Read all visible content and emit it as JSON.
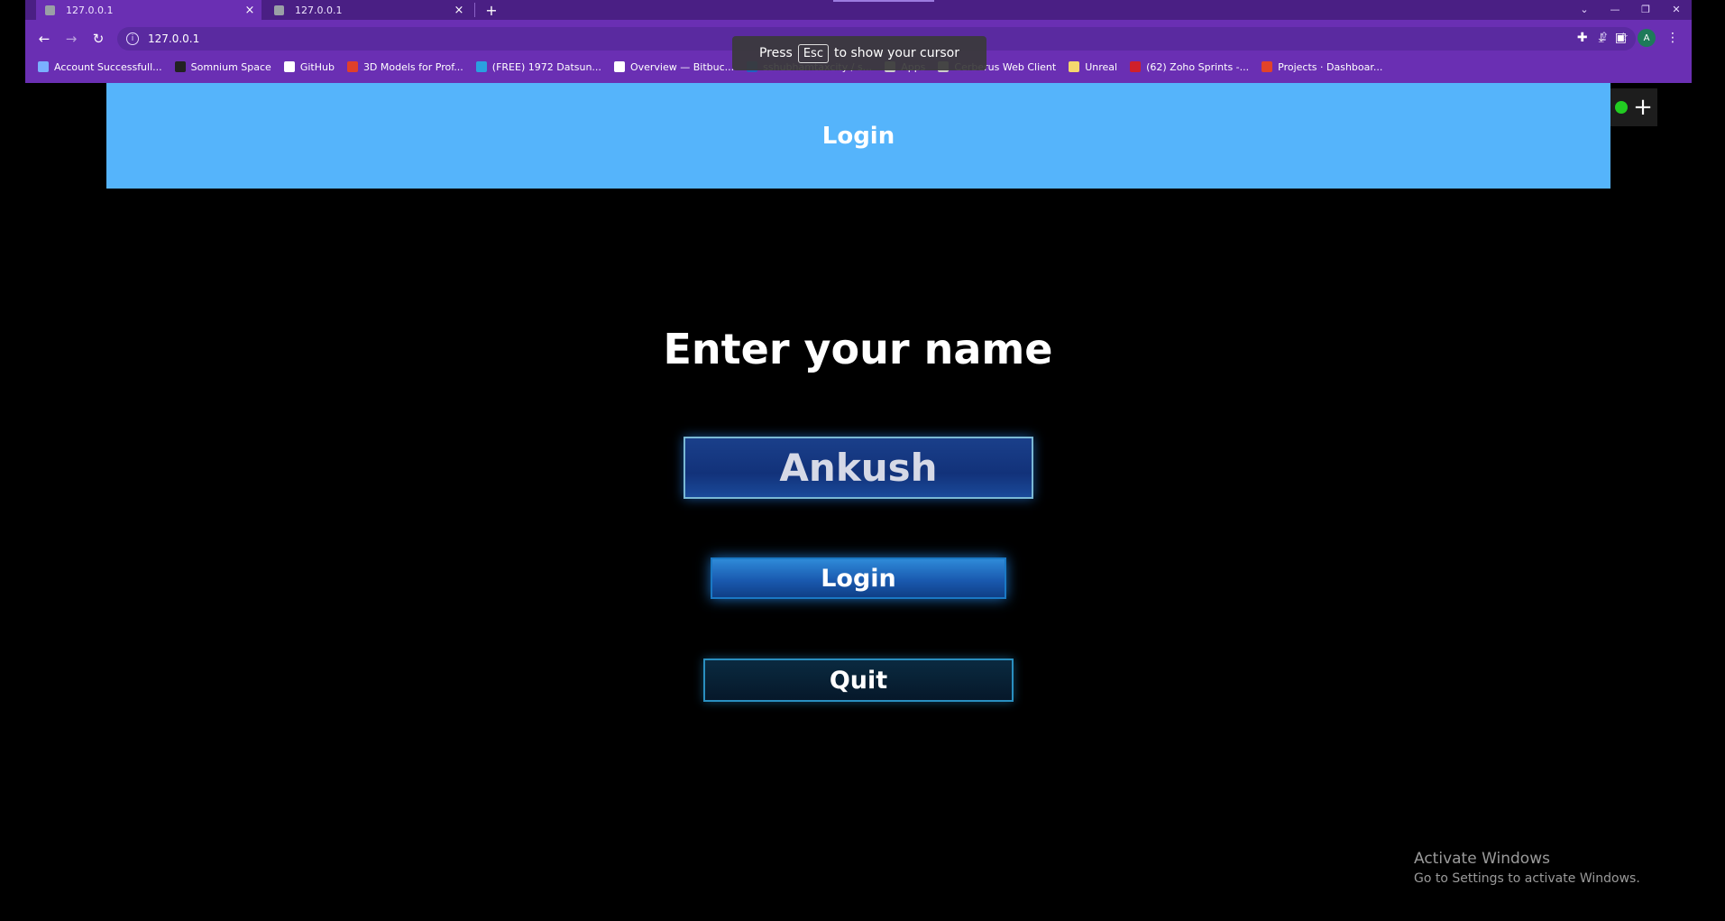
{
  "browser": {
    "tabs": [
      {
        "label": "127.0.0.1",
        "active": true
      },
      {
        "label": "127.0.0.1",
        "active": false
      }
    ],
    "new_tab_symbol": "+",
    "address": "127.0.0.1",
    "bookmarks": [
      {
        "label": "Account Successfull...",
        "icon": "bookmark-icon",
        "color": "#7ab0ff"
      },
      {
        "label": "Somnium Space",
        "icon": "cube-icon",
        "color": "#222222"
      },
      {
        "label": "GitHub",
        "icon": "github-icon",
        "color": "#ffffff"
      },
      {
        "label": "3D Models for Prof...",
        "icon": "star-icon",
        "color": "#e0402a"
      },
      {
        "label": "(FREE) 1972 Datsun...",
        "icon": "globe-icon",
        "color": "#2aa0e0"
      },
      {
        "label": "Overview — Bitbuc...",
        "icon": "globe-icon",
        "color": "#ffffff"
      },
      {
        "label": "sshubhamtaxcity / s...",
        "icon": "repo-icon",
        "color": "#2060c0"
      },
      {
        "label": "Apps",
        "icon": "apps-grid-icon",
        "color": "#cccccc"
      },
      {
        "label": "Cerberus Web Client",
        "icon": "document-icon",
        "color": "#cccccc"
      },
      {
        "label": "Unreal",
        "icon": "folder-icon",
        "color": "#f5d76e"
      },
      {
        "label": "(62) Zoho Sprints -...",
        "icon": "zoho-icon",
        "color": "#d0202a"
      },
      {
        "label": "Projects · Dashboar...",
        "icon": "gitlab-icon",
        "color": "#e24329"
      }
    ],
    "cursor_toast": {
      "prefix": "Press",
      "key": "Esc",
      "suffix": "to show your cursor"
    },
    "profile_initial": "A"
  },
  "app": {
    "header_title": "Login",
    "prompt": "Enter your name",
    "name_input_value": "Ankush",
    "login_button": "Login",
    "quit_button": "Quit",
    "accent_color": "#55b4fb"
  },
  "watermark": {
    "title": "Activate Windows",
    "subtitle": "Go to Settings to activate Windows."
  }
}
